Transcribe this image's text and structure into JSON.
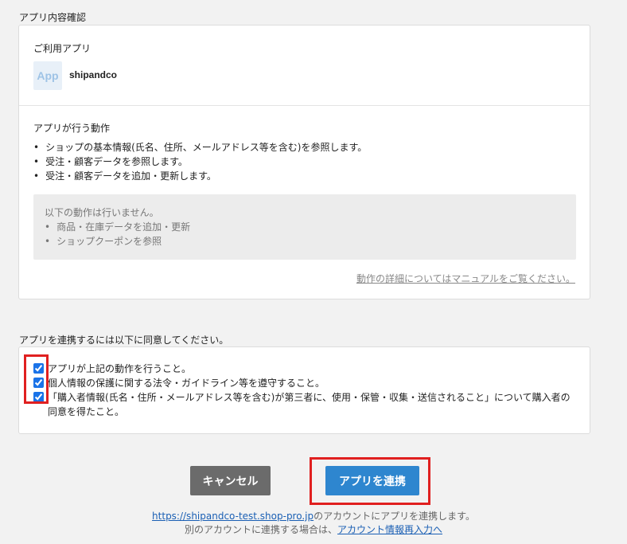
{
  "section1_title": "アプリ内容確認",
  "app": {
    "label": "ご利用アプリ",
    "icon_text": "App",
    "name": "shipandco"
  },
  "actions": {
    "label": "アプリが行う動作",
    "items": [
      "ショップの基本情報(氏名、住所、メールアドレス等を含む)を参照します。",
      "受注・顧客データを参照します。",
      "受注・顧客データを追加・更新します。"
    ],
    "not_title": "以下の動作は行いません。",
    "not_items": [
      "商品・在庫データを追加・更新",
      "ショップクーポンを参照"
    ],
    "manual_link": "動作の詳細についてはマニュアルをご覧ください。"
  },
  "agreement": {
    "title": "アプリを連携するには以下に同意してください。",
    "items": [
      "アプリが上記の動作を行うこと。",
      "個人情報の保護に関する法令・ガイドライン等を遵守すること。",
      "「購入者情報(氏名・住所・メールアドレス等を含む)が第三者に、使用・保管・収集・送信されること」について購入者の同意を得たこと。"
    ]
  },
  "buttons": {
    "cancel": "キャンセル",
    "link": "アプリを連携"
  },
  "footer": {
    "account_url": "https://shipandco-test.shop-pro.jp",
    "account_text": "のアカウントにアプリを連携します。",
    "other_prefix": "別のアカウントに連携する場合は、",
    "other_link": "アカウント情報再入力へ"
  }
}
